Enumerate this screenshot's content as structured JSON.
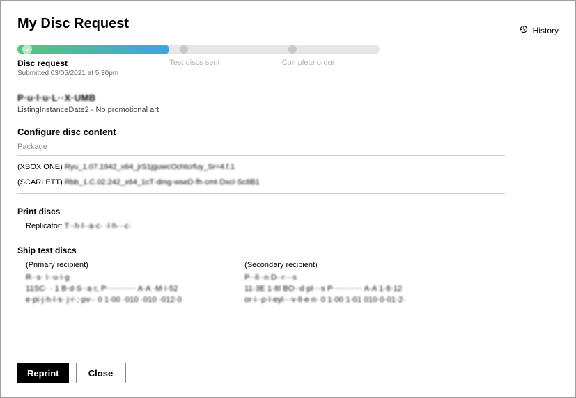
{
  "header": {
    "title": "My Disc Request",
    "history_label": "History"
  },
  "progress": {
    "steps": {
      "s1": {
        "label": "Disc request",
        "sub": "Submitted 03/05/2021 at 5:30pm"
      },
      "s2": {
        "label": "Test discs sent"
      },
      "s3": {
        "label": "Complete order"
      }
    }
  },
  "product": {
    "title_obscured": "P·u·l·u·L··X·UMB",
    "listing_line": "ListingInstanceDate2 - No promotional art"
  },
  "configure": {
    "heading": "Configure disc content",
    "package_label": "Package",
    "packages": [
      {
        "prefix": "(XBOX ONE) ",
        "rest": "Ryu_1.07.1942_x64_jrS1jguwcOchtcrfuy_Sr=4.f.1"
      },
      {
        "prefix": "(SCARLETT) ",
        "rest": "Rbb_1.C.02.242_x64_1cT·dmg·wseD·fh·cmt·Dxcl·Sc8B1"
      }
    ]
  },
  "print": {
    "heading": "Print discs",
    "replicator_label": "Replicator: ",
    "replicator_value": "T··h·l··a·c·  ·l·h···c·"
  },
  "ship": {
    "heading": "Ship test discs",
    "primary": {
      "label": "(Primary recipient)",
      "name": "R··s·  I··u·i·g",
      "addr": "11SC·  · 1 B·d·S··a·r, P···········  A·A  ·M·i·52",
      "contact": "e·pi·j·h·l·s·  j·r·;·pv··  0 1·00 ·010  ·010 ·012·0"
    },
    "secondary": {
      "label": "(Secondary recipient)",
      "name": "P··ll··n  D··r···s",
      "addr": "11·3E  1·8l  BO··d·pl···s  P···········  A·A 1·8·12",
      "contact": "or·i··p·l·eyl···v·ll·e·n·   0 1·00 1·01 010·0·01·2·"
    }
  },
  "buttons": {
    "reprint": "Reprint",
    "close": "Close"
  }
}
